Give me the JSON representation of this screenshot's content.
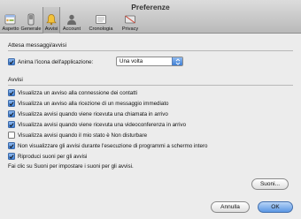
{
  "window": {
    "title": "Preferenze"
  },
  "toolbar": {
    "items": [
      {
        "label": "Aspetto",
        "icon": "appearance-icon"
      },
      {
        "label": "Generale",
        "icon": "general-switch-icon"
      },
      {
        "label": "Avvisi",
        "icon": "bell-icon",
        "selected": true
      },
      {
        "label": "Account",
        "icon": "user-icon"
      },
      {
        "label": "Cronologia",
        "icon": "history-icon"
      },
      {
        "label": "Privacy",
        "icon": "privacy-icon"
      }
    ]
  },
  "waiting_group": {
    "title": "Attesa messaggi/avvisi",
    "animate_checkbox": {
      "label": "Anima l'icona dell'applicazione:",
      "checked": true
    },
    "animate_select": {
      "value": "Una volta"
    }
  },
  "alerts_group": {
    "title": "Avvisi",
    "items": [
      {
        "label": "Visualizza un avviso alla connessione dei contatti",
        "checked": true
      },
      {
        "label": "Visualizza un avviso alla ricezione di un messaggio immediato",
        "checked": true
      },
      {
        "label": "Visualizza avvisi quando viene ricevuta una chiamata in arrivo",
        "checked": true
      },
      {
        "label": "Visualizza avvisi quando viene ricevuta una videoconferenza in arrivo",
        "checked": true
      },
      {
        "label": "Visualizza avvisi quando il mio stato è Non disturbare",
        "checked": false
      },
      {
        "label": "Non visualizzare gli avvisi durante l'esecuzione di programmi a schermo intero",
        "checked": true
      },
      {
        "label": "Riproduci suoni per gli avvisi",
        "checked": true
      }
    ],
    "hint": "Fai clic su Suoni per impostare i suoni per gli avvisi."
  },
  "buttons": {
    "sounds": "Suoni...",
    "cancel": "Annulla",
    "ok": "OK"
  },
  "colors": {
    "accent": "#3d7fd6",
    "window_bg": "#ececec"
  }
}
